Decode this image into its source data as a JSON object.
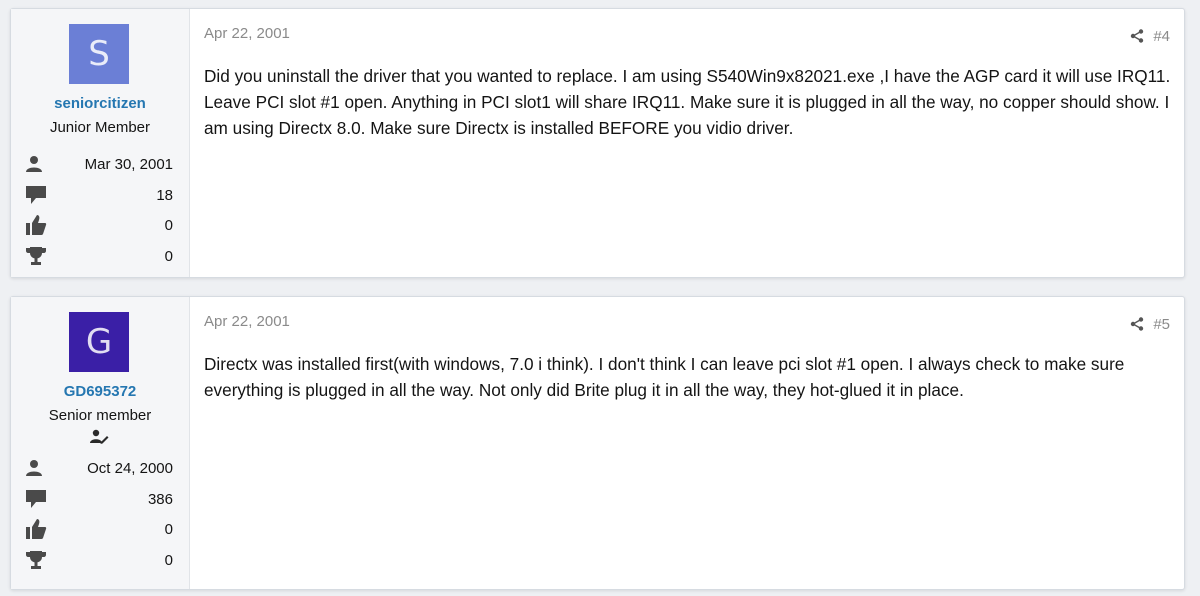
{
  "posts": [
    {
      "avatar_letter": "S",
      "avatar_color": "#6b7fd6",
      "username": "seniorcitizen",
      "user_title": "Junior Member",
      "joined": "Mar 30, 2001",
      "messages": "18",
      "reactions": "0",
      "points": "0",
      "date": "Apr 22, 2001",
      "number": "#4",
      "body": "Did you uninstall the driver that you wanted to replace. I am using S540Win9x82021.exe ,I have the AGP card it will use IRQ11. Leave PCI slot #1 open. Anything in PCI slot1 will share IRQ11. Make sure it is plugged in all the way, no copper should show. I am using Directx 8.0. Make sure Directx is installed BEFORE you vidio driver."
    },
    {
      "avatar_letter": "G",
      "avatar_color": "#3a1fa6",
      "username": "GD695372",
      "user_title": "Senior member",
      "badge_icon": "person-pencil-icon",
      "joined": "Oct 24, 2000",
      "messages": "386",
      "reactions": "0",
      "points": "0",
      "date": "Apr 22, 2001",
      "number": "#5",
      "body": "Directx was installed first(with windows, 7.0 i think). I don't think I can leave pci slot #1 open. I always check to make sure everything is plugged in all the way. Not only did Brite plug it in all the way, they hot-glued it in place."
    }
  ],
  "icons": {
    "joined": "person-icon",
    "messages": "speech-bubble-icon",
    "reactions": "thumbs-up-icon",
    "points": "trophy-icon",
    "share": "share-icon"
  }
}
